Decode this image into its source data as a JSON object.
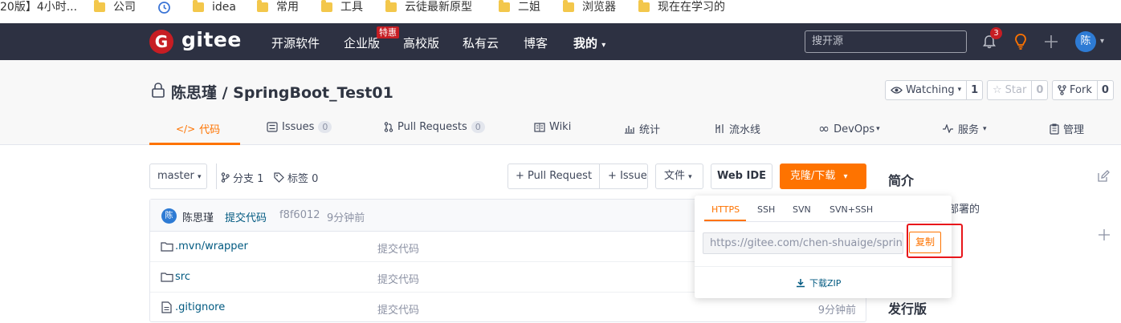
{
  "bookmarks": [
    {
      "label": "20版】4小时...",
      "folder": false
    },
    {
      "label": "公司",
      "folder": true
    },
    {
      "label": "",
      "folder": false,
      "icon": "history-icon"
    },
    {
      "label": "idea",
      "folder": true
    },
    {
      "label": "常用",
      "folder": true
    },
    {
      "label": "工具",
      "folder": true
    },
    {
      "label": "云徒最新原型",
      "folder": true
    },
    {
      "label": "二姐",
      "folder": true
    },
    {
      "label": "浏览器",
      "folder": true
    },
    {
      "label": "现在在学习的",
      "folder": true
    }
  ],
  "nav": {
    "logo_letter": "G",
    "logo_text": "gitee",
    "links": [
      "开源软件",
      "企业版",
      "高校版",
      "私有云",
      "博客",
      "我的"
    ],
    "enterprise_badge": "特惠",
    "search_placeholder": "搜开源",
    "notification_count": "3",
    "avatar_letter": "陈"
  },
  "repo": {
    "title": "陈思瑾 / SpringBoot_Test01",
    "watch_label": "Watching",
    "watch_count": "1",
    "star_label": "Star",
    "star_count": "0",
    "fork_label": "Fork",
    "fork_count": "0",
    "tabs": [
      {
        "label": "代码",
        "count": null
      },
      {
        "label": "Issues",
        "count": "0"
      },
      {
        "label": "Pull Requests",
        "count": "0"
      },
      {
        "label": "Wiki",
        "count": null
      },
      {
        "label": "统计",
        "count": null
      },
      {
        "label": "流水线",
        "count": null
      },
      {
        "label": "DevOps",
        "count": null
      },
      {
        "label": "服务",
        "count": null
      },
      {
        "label": "管理",
        "count": null
      }
    ]
  },
  "toolbar": {
    "branch": "master",
    "branches": "分支 1",
    "tags": "标签 0",
    "pull_request": "+ Pull Request",
    "issue": "+ Issue",
    "file": "文件",
    "web_ide": "Web IDE",
    "clone": "克隆/下载"
  },
  "commit": {
    "avatar_letter": "陈",
    "author": "陈思瑾",
    "message": "提交代码",
    "hash": "f8f6012",
    "time": "9分钟前"
  },
  "files": [
    {
      "name": ".mvn/wrapper",
      "message": "提交代码",
      "time": "",
      "type": "folder"
    },
    {
      "name": "src",
      "message": "提交代码",
      "time": "",
      "type": "folder"
    },
    {
      "name": ".gitignore",
      "message": "提交代码",
      "time": "9分钟前",
      "type": "file"
    }
  ],
  "sidebar": {
    "intro_title": "简介",
    "intro_text_partial": "动部署的",
    "release_title": "发行版"
  },
  "clone_popup": {
    "tabs": [
      "HTTPS",
      "SSH",
      "SVN",
      "SVN+SSH"
    ],
    "url": "https://gitee.com/chen-shuaige/spring",
    "copy_label": "复制",
    "zip_label": "下载ZIP"
  },
  "colors": {
    "accent": "#fe7300",
    "nav_bg": "#2d3142",
    "brand_red": "#c71d23",
    "highlight_box": "#e8161b"
  }
}
